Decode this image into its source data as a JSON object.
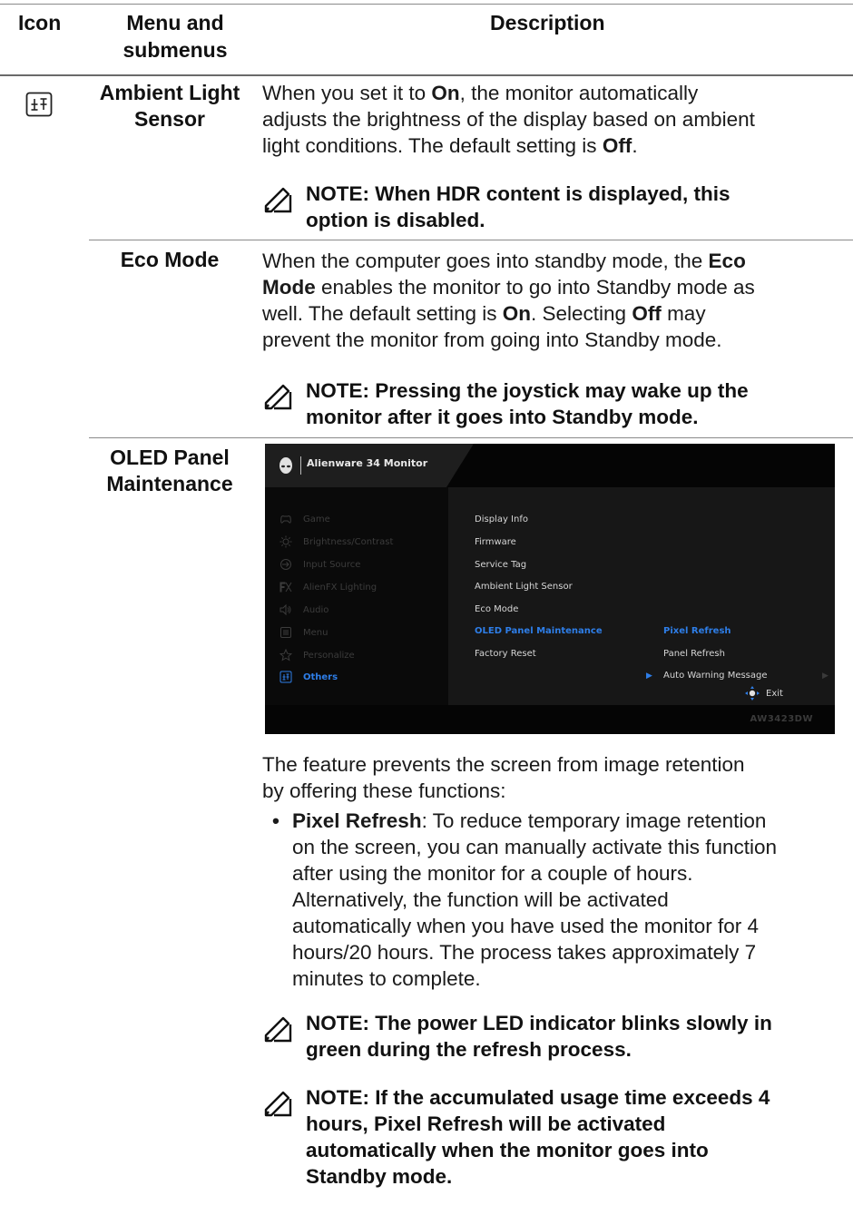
{
  "header": {
    "icon_col": "Icon",
    "menu_col": "Menu and submenus",
    "desc_col": "Description"
  },
  "rows": {
    "ambient": {
      "icon": "others-icon",
      "name_l1": "Ambient Light",
      "name_l2": "Sensor",
      "desc_l1_a": "When you set it to ",
      "desc_l1_b": "On",
      "desc_l1_c": ", the monitor automatically",
      "desc_l2": "adjusts the brightness of the display based on ambient",
      "desc_l3_a": "light conditions. The default setting is ",
      "desc_l3_b": "Off",
      "desc_l3_c": ".",
      "note_l1": "NOTE: When HDR content is displayed, this",
      "note_l2": "option is disabled."
    },
    "eco": {
      "name": "Eco Mode",
      "desc_l1_a": "When the computer goes into standby mode, the ",
      "desc_l1_b": "Eco",
      "desc_l2_a": "Mode",
      "desc_l2_b": " enables the monitor to go into Standby mode as",
      "desc_l3_a": "well. The default setting is ",
      "desc_l3_b": "On",
      "desc_l3_c": ". Selecting ",
      "desc_l3_d": "Off",
      "desc_l3_e": " may",
      "desc_l4": "prevent the monitor from going into Standby mode.",
      "note_l1": "NOTE: Pressing the joystick may wake up the",
      "note_l2": "monitor after it goes into Standby mode."
    },
    "oled": {
      "name_l1": "OLED Panel",
      "name_l2": "Maintenance",
      "intro_l1": "The feature prevents the screen from image retention",
      "intro_l2": "by offering these functions:",
      "bullet_marker": "•",
      "bullet_bold": "Pixel Refresh",
      "bullet_l1": ": To reduce temporary image retention",
      "bullet_l2": "on the screen, you can manually activate this function",
      "bullet_l3": "after using the monitor for a couple of hours.",
      "bullet_l4": "Alternatively, the function will be activated",
      "bullet_l5": "automatically when you have used the monitor for 4",
      "bullet_l6": "hours/20 hours. The process takes approximately 7",
      "bullet_l7": "minutes to complete.",
      "note1_l1": "NOTE: The power LED indicator blinks slowly in",
      "note1_l2": "green during the refresh process.",
      "note2_l1": "NOTE: If the accumulated usage time exceeds 4",
      "note2_l2": "hours, Pixel Refresh will be activated",
      "note2_l3": "automatically when the monitor goes into",
      "note2_l4": "Standby mode."
    }
  },
  "osd": {
    "title": "Alienware 34 Monitor",
    "model": "AW3423DW",
    "exit_label": "Exit",
    "menu": [
      {
        "label": "Game",
        "icon": "gamepad-icon"
      },
      {
        "label": "Brightness/Contrast",
        "icon": "brightness-icon"
      },
      {
        "label": "Input Source",
        "icon": "input-icon"
      },
      {
        "label": "AlienFX Lighting",
        "icon": "alienfx-icon"
      },
      {
        "label": "Audio",
        "icon": "speaker-icon"
      },
      {
        "label": "Menu",
        "icon": "menu-icon"
      },
      {
        "label": "Personalize",
        "icon": "star-icon"
      },
      {
        "label": "Others",
        "icon": "others-icon",
        "active": true
      }
    ],
    "submenu": [
      {
        "label": "Display Info"
      },
      {
        "label": "Firmware"
      },
      {
        "label": "Service Tag"
      },
      {
        "label": "Ambient Light Sensor"
      },
      {
        "label": "Eco Mode"
      },
      {
        "label": "OLED Panel Maintenance",
        "active": true
      },
      {
        "label": "Factory Reset"
      }
    ],
    "options": [
      {
        "label": "Pixel Refresh",
        "active": true
      },
      {
        "label": "Panel Refresh"
      },
      {
        "label": "Auto Warning Message"
      }
    ],
    "colors": {
      "accent": "#2e7ee8",
      "background": "#0d0d0d"
    }
  }
}
